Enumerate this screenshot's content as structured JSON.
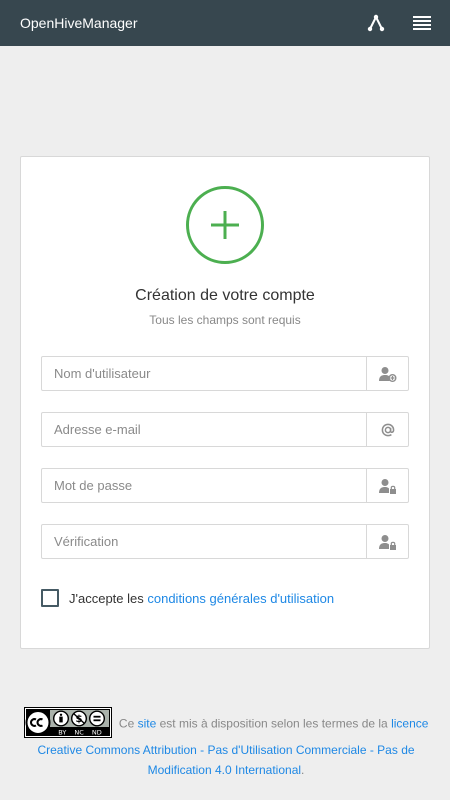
{
  "app": {
    "title": "OpenHiveManager"
  },
  "header": {
    "icons": [
      "share-icon",
      "menu-icon"
    ]
  },
  "card": {
    "title": "Création de votre compte",
    "subtitle": "Tous les champs sont requis",
    "accent_color": "#4caf50",
    "fields": [
      {
        "placeholder": "Nom d'utilisateur",
        "value": "",
        "icon": "user-add-icon"
      },
      {
        "placeholder": "Adresse e-mail",
        "value": "",
        "icon": "at-icon"
      },
      {
        "placeholder": "Mot de passe",
        "value": "",
        "icon": "user-lock-icon"
      },
      {
        "placeholder": "Vérification",
        "value": "",
        "icon": "user-lock-icon"
      }
    ],
    "terms": {
      "checked": false,
      "prefix": "J'accepte les ",
      "link": "conditions générales d'utilisation"
    }
  },
  "footer": {
    "badge": {
      "text": "BY NC ND"
    },
    "text1": " Ce ",
    "link1": "site",
    "text2": " est mis à disposition selon les termes de la ",
    "link2": "licence Creative Commons Attribution - Pas d'Utilisation Commerciale - Pas de Modification 4.0 International",
    "text3": "."
  },
  "colors": {
    "topbar": "#37474f",
    "link": "#1e88e5",
    "background": "#eeeeee"
  }
}
